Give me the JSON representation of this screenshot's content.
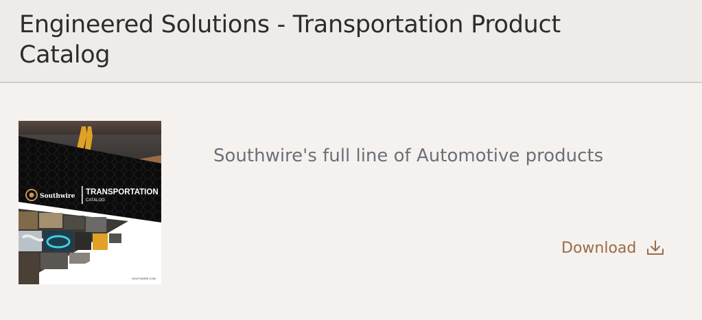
{
  "header": {
    "title": "Engineered Solutions - Transportation Product Catalog"
  },
  "card": {
    "description": "Southwire's full line of Automotive products",
    "download_label": "Download",
    "download_icon": "download-icon"
  },
  "catalog_cover": {
    "brand": "Southwire",
    "heading": "TRANSPORTATION",
    "subheading": "CATALOG",
    "website": "SOUTHWIRE.COM"
  },
  "colors": {
    "accent": "#9a6b46",
    "header_bg": "#eeebe9",
    "page_bg": "#f5f1ee"
  }
}
